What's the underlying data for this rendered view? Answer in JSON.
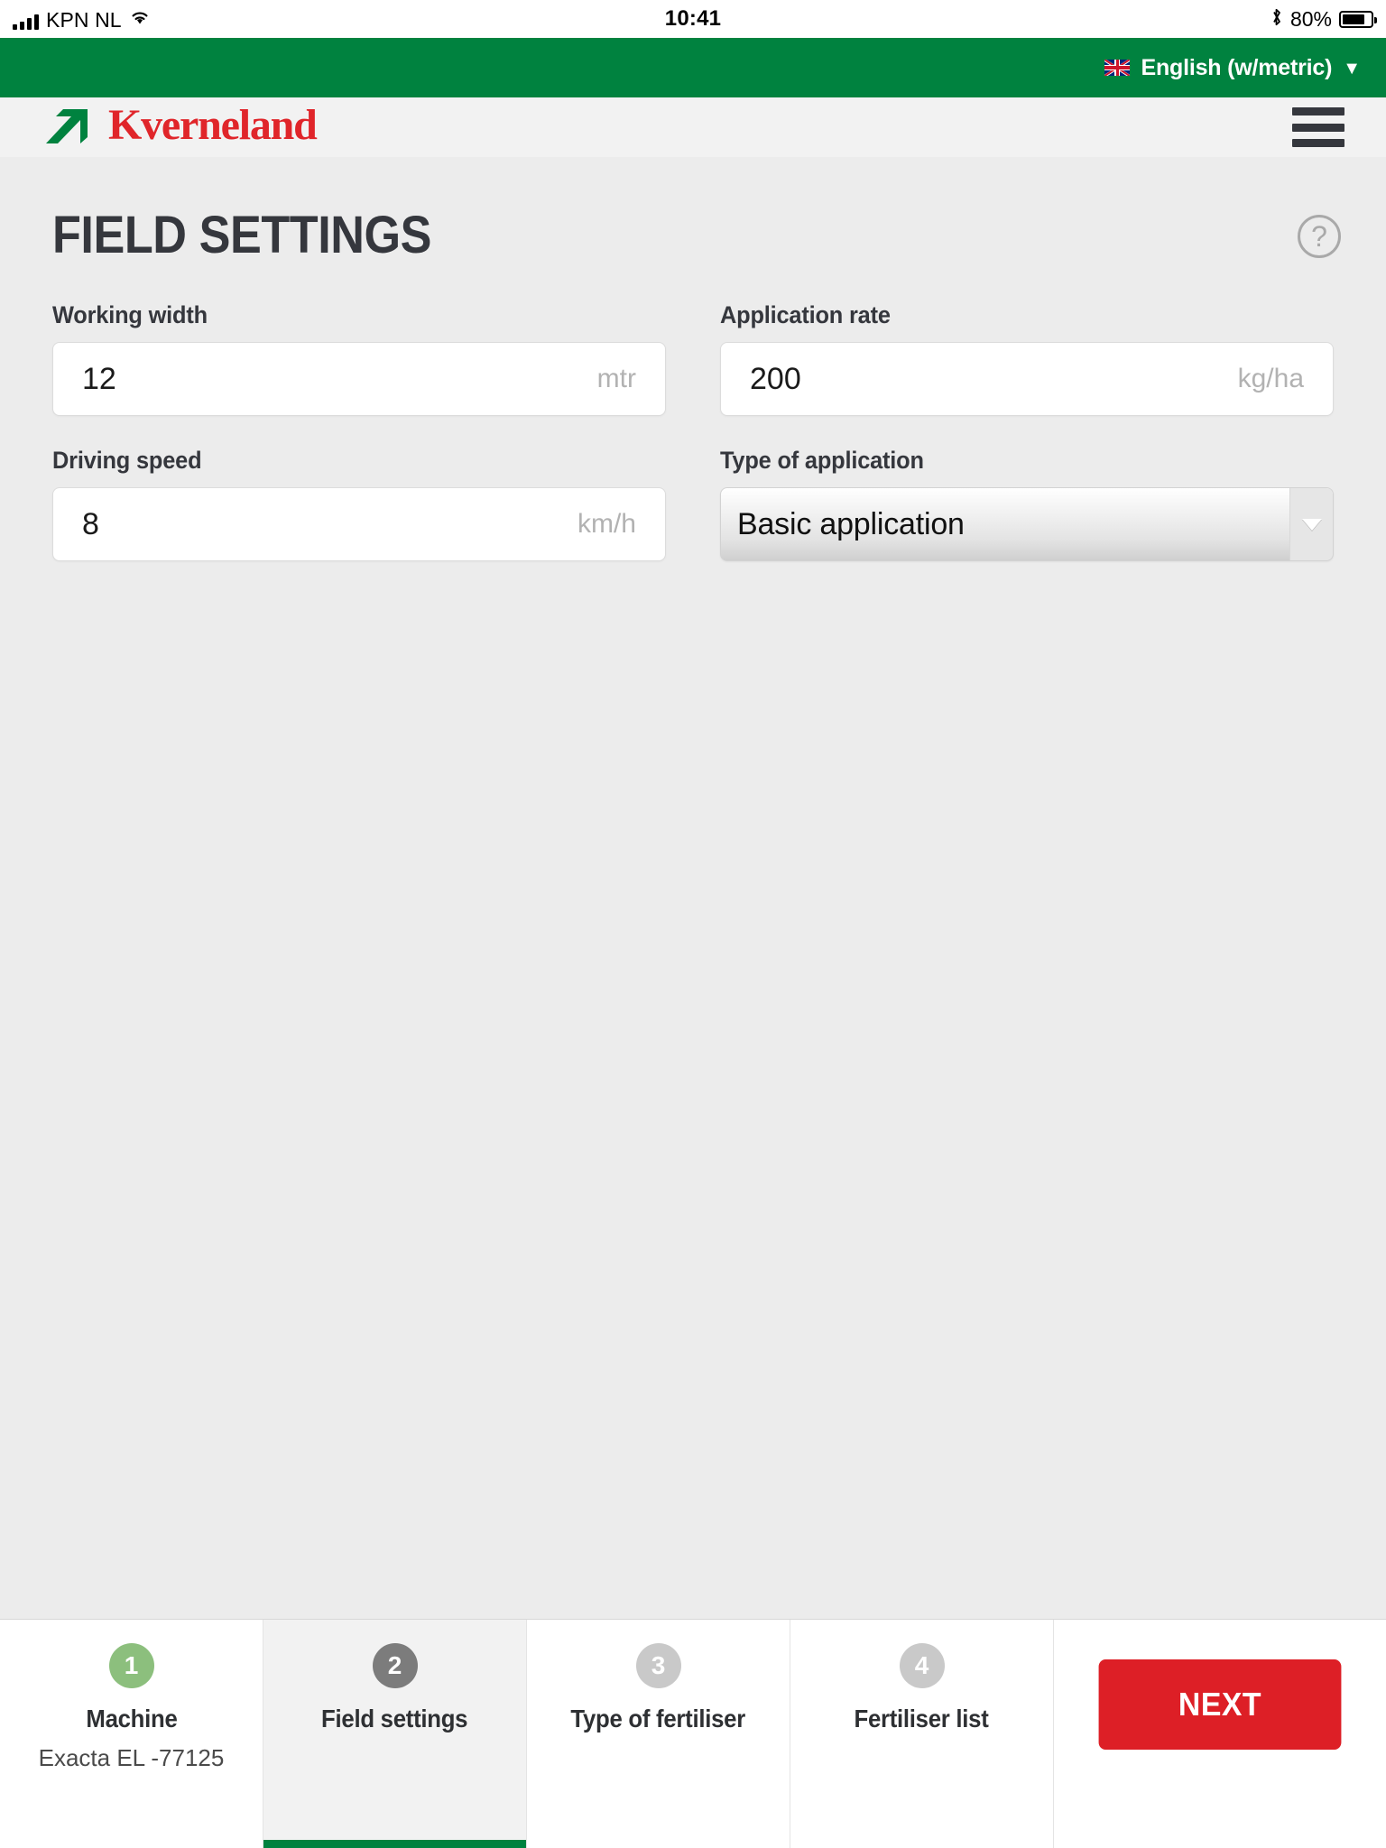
{
  "status_bar": {
    "carrier": "KPN NL",
    "time": "10:41",
    "battery_percent": "80%",
    "signal_icon": "cellular-signal-icon",
    "wifi_icon": "wifi-icon",
    "bluetooth_icon": "bluetooth-icon",
    "battery_icon": "battery-icon"
  },
  "language_bar": {
    "flag_icon": "uk-flag-icon",
    "label": "English (w/metric)",
    "caret": "▼"
  },
  "header": {
    "brand": "Kverneland",
    "logo_icon": "kverneland-arrow-logo",
    "menu_icon": "hamburger-menu-icon",
    "brand_red": "#e0252a",
    "brand_green": "#00823f"
  },
  "main": {
    "title": "FIELD SETTINGS",
    "help_icon": "help-question-icon",
    "help_label": "?",
    "fields": [
      {
        "label": "Working width",
        "value": "12",
        "unit": "mtr",
        "type": "number"
      },
      {
        "label": "Application rate",
        "value": "200",
        "unit": "kg/ha",
        "type": "number"
      },
      {
        "label": "Driving speed",
        "value": "8",
        "unit": "km/h",
        "type": "number"
      },
      {
        "label": "Type of application",
        "value": "Basic application",
        "unit": "",
        "type": "select"
      }
    ]
  },
  "step_bar": {
    "steps": [
      {
        "number": "1",
        "label": "Machine",
        "sub": "Exacta EL -77125",
        "state": "complete",
        "color": "#8cbf7d"
      },
      {
        "number": "2",
        "label": "Field settings",
        "sub": "",
        "state": "active",
        "color": "#7c7c7c"
      },
      {
        "number": "3",
        "label": "Type of fertiliser",
        "sub": "",
        "state": "upcoming",
        "color": "#c9c9c9"
      },
      {
        "number": "4",
        "label": "Fertiliser list",
        "sub": "",
        "state": "upcoming",
        "color": "#c9c9c9"
      }
    ],
    "next_label": "NEXT",
    "next_color": "#dd1f26",
    "active_underline_color": "#00823f"
  }
}
